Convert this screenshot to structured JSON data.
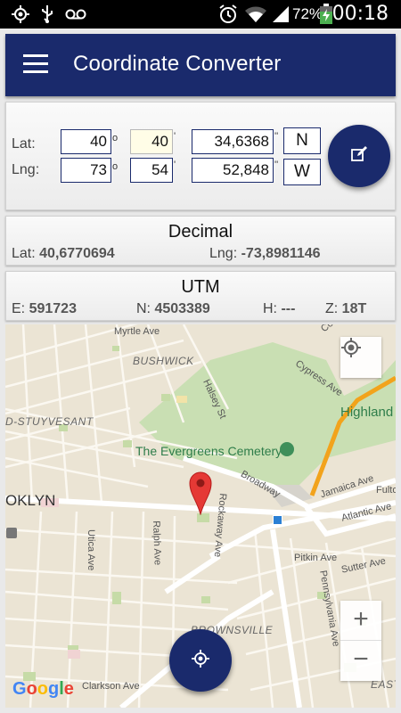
{
  "status_bar": {
    "battery_percent": "72%",
    "time": "00:18",
    "icons": [
      "gps-icon",
      "usb-icon",
      "voicemail-icon",
      "alarm-icon",
      "wifi-icon",
      "signal-icon",
      "battery-charging-icon"
    ]
  },
  "app_bar": {
    "title": "Coordinate Converter",
    "menu_icon": "hamburger-menu-icon"
  },
  "input": {
    "lat_label": "Lat:",
    "lng_label": "Lng:",
    "lat_deg": "40",
    "lat_min": "40",
    "lat_sec": "34,6368",
    "lat_dir": "N",
    "lng_deg": "73",
    "lng_min": "54",
    "lng_sec": "52,848",
    "lng_dir": "W",
    "deg_unit": "o",
    "min_unit": "'",
    "sec_unit": "''",
    "edit_icon": "edit-icon"
  },
  "decimal": {
    "title": "Decimal",
    "lat_label": "Lat:",
    "lat_value": "40,6770694",
    "lng_label": "Lng:",
    "lng_value": "-73,8981146"
  },
  "utm": {
    "title": "UTM",
    "e_label": "E:",
    "e_value": "591723",
    "n_label": "N:",
    "n_value": "4503389",
    "h_label": "H:",
    "h_value": "---",
    "z_label": "Z:",
    "z_value": "18T"
  },
  "map": {
    "labels": {
      "myrtle_ave": "Myrtle Ave",
      "bushwick": "BUSHWICK",
      "cooper_ave": "Cooper Av",
      "cypress_ave": "Cypress Ave",
      "halsey_st": "Halsey St",
      "highland_park": "Highland P",
      "stuyvesant": "D-STUYVESANT",
      "evergreens": "The Evergreens Cemetery",
      "broadway": "Broadway",
      "jamaica_ave": "Jamaica Ave",
      "fulton": "Fulto",
      "brooklyn": "OKLYN",
      "utica_ave": "Utica Ave",
      "ralph_ave": "Ralph Ave",
      "rockaway_ave": "Rockaway Ave",
      "atlantic_ave": "Atlantic Ave",
      "pitkin_ave": "Pitkin Ave",
      "sutter_ave": "Sutter Ave",
      "pennsylvania_ave": "Pennsylvania Ave",
      "brownsville": "BROWNSVILLE",
      "clarkson_ave": "Clarkson Ave",
      "east": "EAST",
      "google": "Google"
    },
    "zoom_in": "+",
    "zoom_out": "−",
    "my_location_icon": "my-location-icon",
    "locate_fab_icon": "crosshair-icon",
    "marker_icon": "map-pin-icon"
  }
}
